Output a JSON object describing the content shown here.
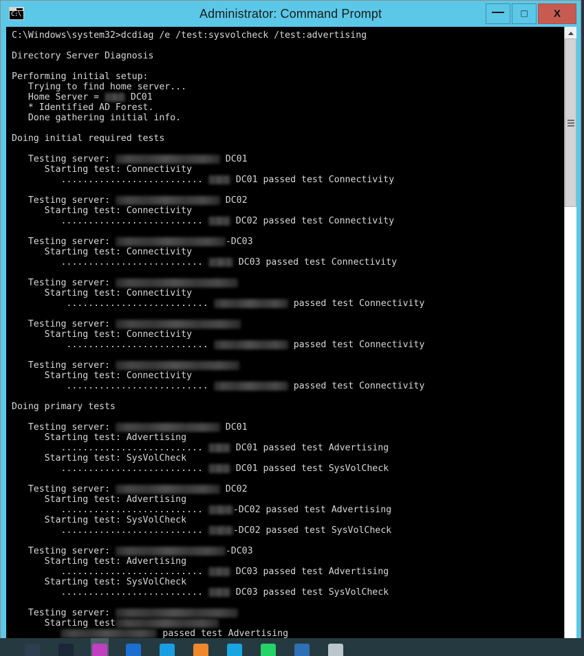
{
  "window": {
    "title": "Administrator: Command Prompt",
    "icon": "command-prompt-icon",
    "icon_text": "C:\\",
    "controls": {
      "minimize": "—",
      "maximize": "□",
      "close": "X"
    },
    "accent_color": "#5bc8e8",
    "close_color": "#c75b52",
    "console_bg": "#000000",
    "console_fg": "#d8d8d8"
  },
  "scrollbar": {
    "up_arrow": "scroll-up-arrow",
    "thumb": "scroll-thumb",
    "grip": "scroll-grip"
  },
  "console": {
    "prompt_path": "C:\\Windows\\system32>",
    "command": "dcdiag /e /test:sysvolcheck /test:advertising",
    "lines": [
      {
        "type": "cmd",
        "text": "C:\\Windows\\system32>dcdiag /e /test:sysvolcheck /test:advertising"
      },
      {
        "type": "blank",
        "text": ""
      },
      {
        "type": "text",
        "text": "Directory Server Diagnosis"
      },
      {
        "type": "blank",
        "text": ""
      },
      {
        "type": "text",
        "text": "Performing initial setup:"
      },
      {
        "type": "text",
        "text": "   Trying to find home server..."
      },
      {
        "type": "redacted",
        "pre": "   Home Server = ",
        "redact_width": 30,
        "post": " DC01"
      },
      {
        "type": "text",
        "text": "   * Identified AD Forest."
      },
      {
        "type": "text",
        "text": "   Done gathering initial info."
      },
      {
        "type": "blank",
        "text": ""
      },
      {
        "type": "text",
        "text": "Doing initial required tests"
      },
      {
        "type": "blank",
        "text": ""
      },
      {
        "type": "redacted",
        "pre": "   Testing server: ",
        "redact_width": 152,
        "post": " DC01"
      },
      {
        "type": "text",
        "text": "      Starting test: Connectivity"
      },
      {
        "type": "redacted",
        "pre": "         .......................... ",
        "redact_width": 32,
        "post": " DC01 passed test Connectivity"
      },
      {
        "type": "blank",
        "text": ""
      },
      {
        "type": "redacted",
        "pre": "   Testing server: ",
        "redact_width": 152,
        "post": " DC02"
      },
      {
        "type": "text",
        "text": "      Starting test: Connectivity"
      },
      {
        "type": "redacted",
        "pre": "         .......................... ",
        "redact_width": 32,
        "post": " DC02 passed test Connectivity"
      },
      {
        "type": "blank",
        "text": ""
      },
      {
        "type": "redacted",
        "pre": "   Testing server: ",
        "redact_width": 160,
        "post": "-DC03"
      },
      {
        "type": "text",
        "text": "      Starting test: Connectivity"
      },
      {
        "type": "redacted",
        "pre": "         .......................... ",
        "redact_width": 36,
        "post": " DC03 passed test Connectivity"
      },
      {
        "type": "blank",
        "text": ""
      },
      {
        "type": "redacted",
        "pre": "   Testing server: ",
        "redact_width": 178,
        "post": ""
      },
      {
        "type": "text",
        "text": "      Starting test: Connectivity"
      },
      {
        "type": "redacted",
        "pre": "          .......................... ",
        "redact_width": 108,
        "post": " passed test Connectivity"
      },
      {
        "type": "blank",
        "text": ""
      },
      {
        "type": "redacted",
        "pre": "   Testing server: ",
        "redact_width": 182,
        "post": ""
      },
      {
        "type": "text",
        "text": "      Starting test: Connectivity"
      },
      {
        "type": "redacted",
        "pre": "          .......................... ",
        "redact_width": 108,
        "post": " passed test Connectivity"
      },
      {
        "type": "blank",
        "text": ""
      },
      {
        "type": "redacted",
        "pre": "   Testing server: ",
        "redact_width": 180,
        "post": ""
      },
      {
        "type": "text",
        "text": "      Starting test: Connectivity"
      },
      {
        "type": "redacted",
        "pre": "          .......................... ",
        "redact_width": 108,
        "post": " passed test Connectivity"
      },
      {
        "type": "blank",
        "text": ""
      },
      {
        "type": "text",
        "text": "Doing primary tests"
      },
      {
        "type": "blank",
        "text": ""
      },
      {
        "type": "redacted",
        "pre": "   Testing server: ",
        "redact_width": 152,
        "post": " DC01"
      },
      {
        "type": "text",
        "text": "      Starting test: Advertising"
      },
      {
        "type": "redacted",
        "pre": "         .......................... ",
        "redact_width": 32,
        "post": " DC01 passed test Advertising"
      },
      {
        "type": "text",
        "text": "      Starting test: SysVolCheck"
      },
      {
        "type": "redacted",
        "pre": "         .......................... ",
        "redact_width": 32,
        "post": " DC01 passed test SysVolCheck"
      },
      {
        "type": "blank",
        "text": ""
      },
      {
        "type": "redacted",
        "pre": "   Testing server: ",
        "redact_width": 152,
        "post": " DC02"
      },
      {
        "type": "text",
        "text": "      Starting test: Advertising"
      },
      {
        "type": "redacted",
        "pre": "         .......................... ",
        "redact_width": 36,
        "post": "-DC02 passed test Advertising"
      },
      {
        "type": "text",
        "text": "      Starting test: SysVolCheck"
      },
      {
        "type": "redacted",
        "pre": "         .......................... ",
        "redact_width": 36,
        "post": "-DC02 passed test SysVolCheck"
      },
      {
        "type": "blank",
        "text": ""
      },
      {
        "type": "redacted",
        "pre": "   Testing server: ",
        "redact_width": 160,
        "post": "-DC03"
      },
      {
        "type": "text",
        "text": "      Starting test: Advertising"
      },
      {
        "type": "redacted",
        "pre": "         .......................... ",
        "redact_width": 32,
        "post": " DC03 passed test Advertising"
      },
      {
        "type": "text",
        "text": "      Starting test: SysVolCheck"
      },
      {
        "type": "redacted",
        "pre": "         .......................... ",
        "redact_width": 32,
        "post": " DC03 passed test SysVolCheck"
      },
      {
        "type": "blank",
        "text": ""
      },
      {
        "type": "redacted",
        "pre": "   Testing server: ",
        "redact_width": 178,
        "post": ""
      },
      {
        "type": "redacted",
        "pre": "      Starting test",
        "redact_width": 150,
        "post": ""
      },
      {
        "type": "redacted",
        "pre": "         ",
        "redact_width": 140,
        "post": " passed test Advertising"
      }
    ]
  },
  "taskbar": {
    "icons": [
      {
        "name": "pen-tool-icon",
        "color": "#2c3e50"
      },
      {
        "name": "browser-globe-icon",
        "color": "#1b2838"
      },
      {
        "name": "photos-app-icon",
        "color": "#c040c0"
      },
      {
        "name": "store-app-icon",
        "color": "#1c6fd0"
      },
      {
        "name": "edge-browser-icon",
        "color": "#1b9de2"
      },
      {
        "name": "firefox-browser-icon",
        "color": "#f0872a"
      },
      {
        "name": "dropbox-icon",
        "color": "#17a6e0"
      },
      {
        "name": "whatsapp-icon",
        "color": "#25d366"
      },
      {
        "name": "window-app-icon",
        "color": "#2f6fb5"
      },
      {
        "name": "file-explorer-icon",
        "color": "#b9c6cc"
      }
    ]
  }
}
